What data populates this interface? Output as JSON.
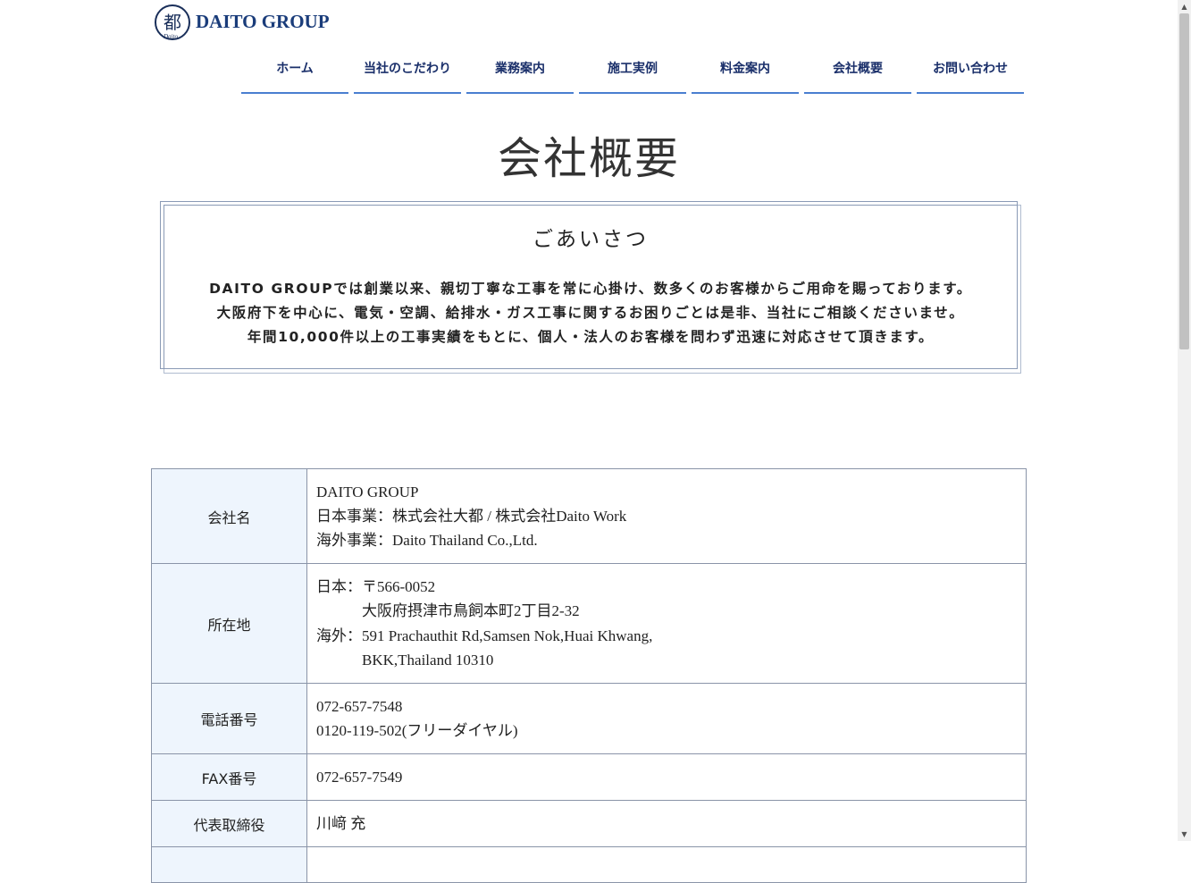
{
  "brand": {
    "name": "DAITO GROUP",
    "logo_kanji": "都",
    "logo_script": "Daito"
  },
  "nav": {
    "items": [
      "ホーム",
      "当社のこだわり",
      "業務案内",
      "施工実例",
      "料金案内",
      "会社概要",
      "お問い合わせ"
    ]
  },
  "page_title": "会社概要",
  "greeting": {
    "title": "ごあいさつ",
    "lines": [
      "DAITO GROUPでは創業以来、親切丁寧な工事を常に心掛け、数多くのお客様からご用命を賜っております。",
      "大阪府下を中心に、電気・空調、給排水・ガス工事に関するお困りごとは是非、当社にご相談くださいませ。",
      "年間10,000件以上の工事実績をもとに、個人・法人のお客様を問わず迅速に対応させて頂きます。"
    ]
  },
  "company_info": {
    "name": {
      "label": "会社名",
      "lines": [
        "DAITO GROUP",
        "日本事業：株式会社大都 / 株式会社Daito Work",
        "海外事業：Daito Thailand Co.,Ltd."
      ]
    },
    "address": {
      "label": "所在地",
      "jp_prefix": "日本：",
      "jp_line1": "〒566-0052",
      "jp_line2": "大阪府摂津市鳥飼本町2丁目2-32",
      "os_prefix": "海外：",
      "os_line1": "591 Prachauthit Rd,Samsen Nok,Huai Khwang,",
      "os_line2": "BKK,Thailand 10310"
    },
    "phone": {
      "label": "電話番号",
      "lines": [
        "072-657-7548",
        "0120-119-502(フリーダイヤル)"
      ]
    },
    "fax": {
      "label": "FAX番号",
      "value": "072-657-7549"
    },
    "ceo": {
      "label": "代表取締役",
      "value": "川﨑 充"
    }
  },
  "colors": {
    "nav_text": "#1a2f6a",
    "nav_underline": "#4a7fd0",
    "table_header_bg": "#eef5fd",
    "brand": "#1a3c7a"
  }
}
